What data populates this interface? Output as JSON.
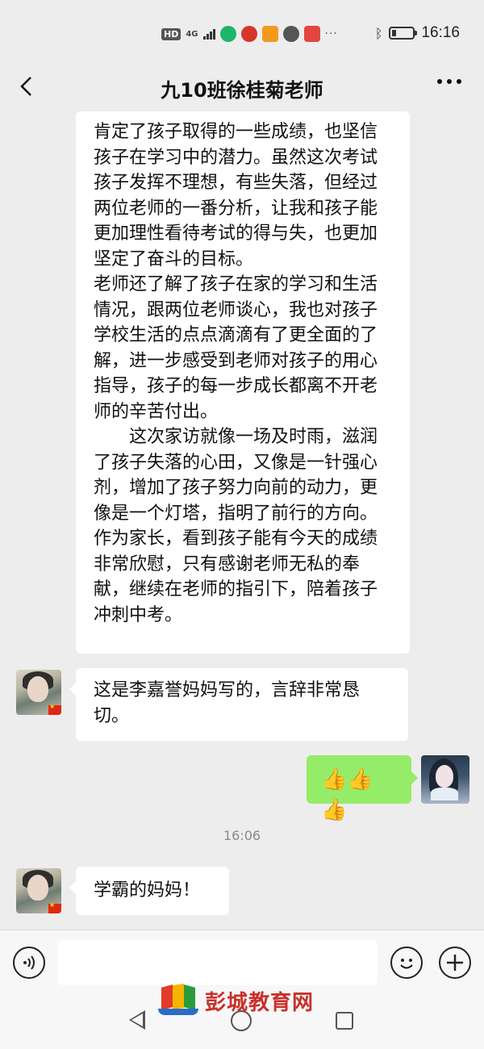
{
  "status_bar": {
    "hd_badge": "HD",
    "network": "4G",
    "icons": [
      "app-green-icon",
      "app-red-icon",
      "app-orange-icon",
      "app-grey-icon",
      "app-red-square-icon"
    ],
    "more": "···",
    "bluetooth_icon": "bluetooth-icon",
    "battery_level": 0.2,
    "time": "16:16"
  },
  "header": {
    "back_icon": "chevron-left-icon",
    "title": "九10班徐桂菊老师",
    "more_icon": "ellipsis-icon"
  },
  "messages": {
    "long_text": {
      "para1": "肯定了孩子取得的一些成绩，也坚信孩子在学习中的潜力。虽然这次考试孩子发挥不理想，有些失落，但经过两位老师的一番分析，让我和孩子能更加理性看待考试的得与失，也更加坚定了奋斗的目标。",
      "para2": "老师还了解了孩子在家的学习和生活情况，跟两位老师谈心，我也对孩子学校生活的点点滴滴有了更全面的了解，进一步感受到老师对孩子的用心指导，孩子的每一步成长都离不开老师的辛苦付出。",
      "para3": "这次家访就像一场及时雨，滋润了孩子失落的心田，又像是一针强心剂，增加了孩子努力向前的动力，更像是一个灯塔，指明了前行的方向。作为家长，看到孩子能有今天的成绩非常欣慰，只有感谢老师无私的奉献，继续在老师的指引下，陪着孩子冲刺中考。"
    },
    "msg2": "这是李嘉誉妈妈写的，言辞非常恳切。",
    "msg3": "👍👍👍",
    "timestamp": "16:06",
    "msg4": "学霸的妈妈！"
  },
  "input_bar": {
    "voice_icon": "voice-icon",
    "emoji_icon": "emoji-icon",
    "plus_icon": "plus-icon",
    "input_value": ""
  },
  "watermark": {
    "text": "彭城教育网"
  },
  "colors": {
    "background": "#ededed",
    "bubble_self": "#95ec69",
    "bubble_other": "#ffffff"
  }
}
